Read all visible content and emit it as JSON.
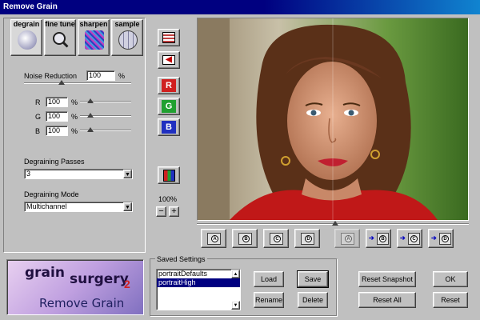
{
  "window": {
    "title": "Remove Grain"
  },
  "tabs": [
    {
      "label": "degrain",
      "icon": "degrain-icon"
    },
    {
      "label": "fine tune",
      "icon": "magnifier-icon"
    },
    {
      "label": "sharpen",
      "icon": "sharpen-grain-icon"
    },
    {
      "label": "sample",
      "icon": "sample-grid-icon"
    }
  ],
  "noise_reduction": {
    "label": "Noise Reduction",
    "value": "100",
    "unit": "%"
  },
  "channels": [
    {
      "label": "R",
      "value": "100",
      "unit": "%"
    },
    {
      "label": "G",
      "value": "100",
      "unit": "%"
    },
    {
      "label": "B",
      "value": "100",
      "unit": "%"
    }
  ],
  "passes": {
    "label": "Degraining Passes",
    "value": "3"
  },
  "mode": {
    "label": "Degraining Mode",
    "value": "Multichannel"
  },
  "toolbar": {
    "channel_letters": [
      "R",
      "G",
      "B"
    ],
    "zoom": "100%",
    "zoom_out": "−",
    "zoom_in": "+"
  },
  "snapshots": [
    "A",
    "B",
    "C",
    "D",
    "A",
    "B",
    "C",
    "D"
  ],
  "saved_settings": {
    "legend": "Saved Settings",
    "items": [
      "portraitDefaults",
      "portraitHigh"
    ],
    "selected_index": 1,
    "load": "Load",
    "save": "Save",
    "rename": "Rename",
    "delete": "Delete"
  },
  "actions": {
    "reset_snapshot": "Reset Snapshot",
    "reset_all": "Reset All",
    "ok": "OK",
    "reset": "Reset"
  },
  "logo": {
    "word1": "grain",
    "word2": "surgery",
    "version": "2",
    "subtitle": "Remove Grain"
  },
  "colors": {
    "accent": "#000080",
    "red": "#d02020",
    "green": "#20a030",
    "blue": "#2030c0"
  }
}
